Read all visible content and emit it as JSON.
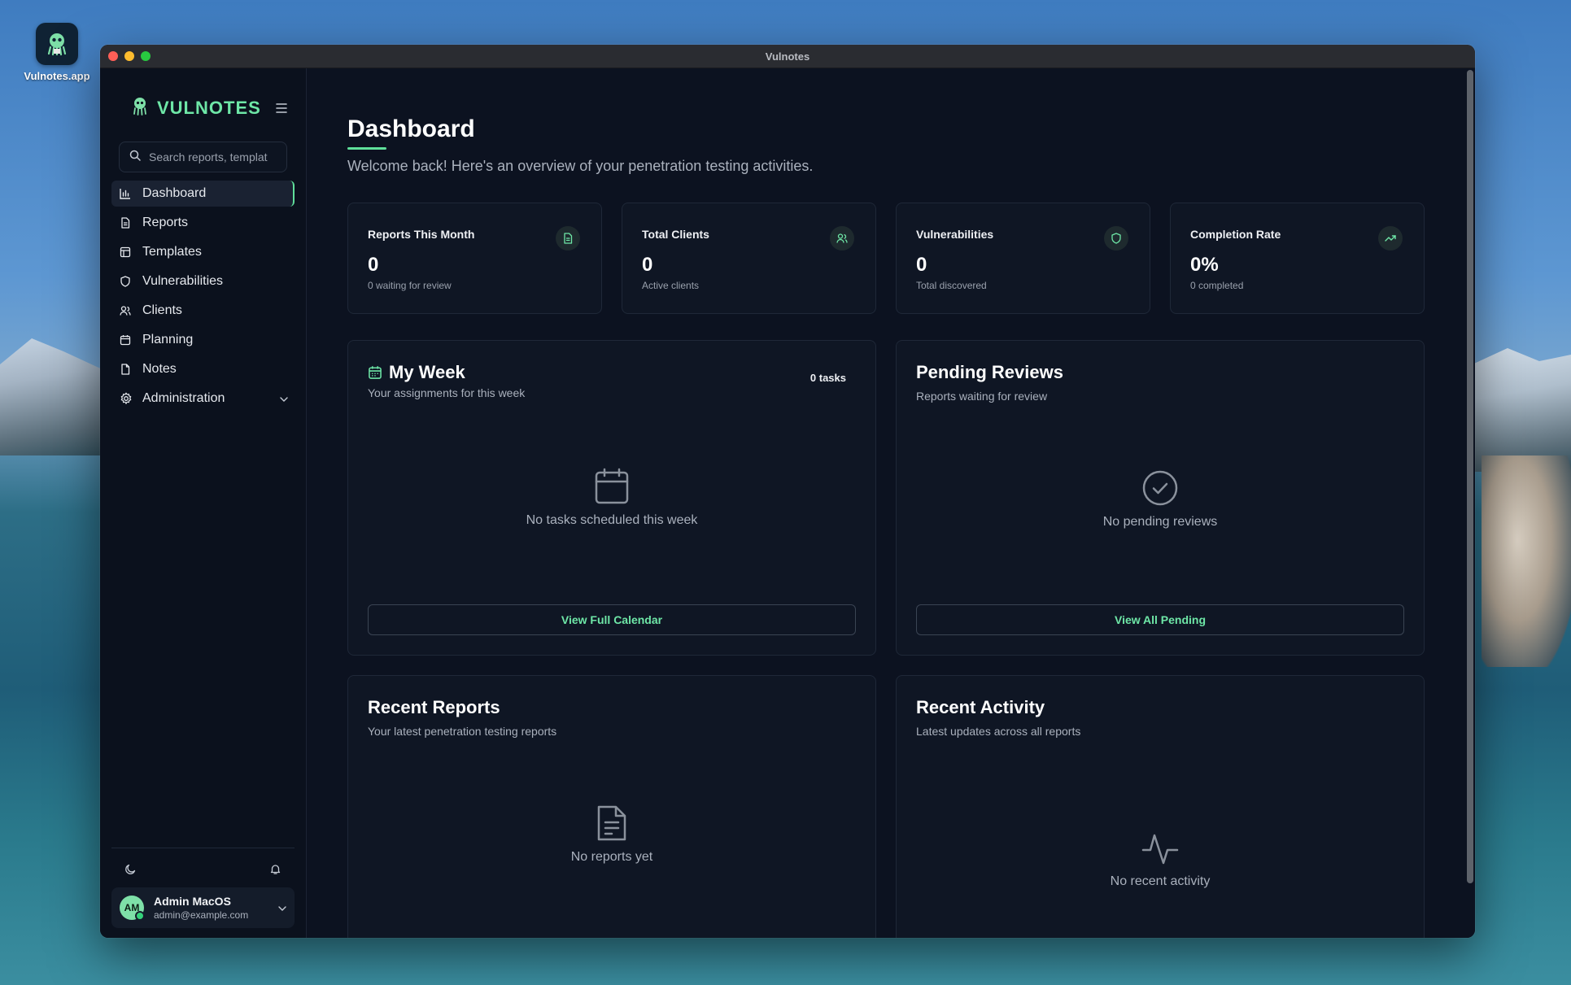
{
  "desktop": {
    "app_icon_label": "Vulnotes.app"
  },
  "window": {
    "title": "Vulnotes"
  },
  "brand": {
    "name": "VULNOTES"
  },
  "search": {
    "placeholder": "Search reports, templat"
  },
  "nav": {
    "items": [
      {
        "label": "Dashboard",
        "icon": "bar-chart-icon",
        "active": true
      },
      {
        "label": "Reports",
        "icon": "file-icon"
      },
      {
        "label": "Templates",
        "icon": "layout-icon"
      },
      {
        "label": "Vulnerabilities",
        "icon": "shield-icon"
      },
      {
        "label": "Clients",
        "icon": "users-icon"
      },
      {
        "label": "Planning",
        "icon": "calendar-icon"
      },
      {
        "label": "Notes",
        "icon": "note-icon"
      },
      {
        "label": "Administration",
        "icon": "gear-icon"
      }
    ]
  },
  "user": {
    "initials": "AM",
    "name": "Admin MacOS",
    "email": "admin@example.com"
  },
  "page": {
    "title": "Dashboard",
    "subtitle": "Welcome back! Here's an overview of your penetration testing activities."
  },
  "stats": [
    {
      "label": "Reports This Month",
      "value": "0",
      "sub": "0 waiting for review",
      "icon": "document-icon"
    },
    {
      "label": "Total Clients",
      "value": "0",
      "sub": "Active clients",
      "icon": "users-icon"
    },
    {
      "label": "Vulnerabilities",
      "value": "0",
      "sub": "Total discovered",
      "icon": "shield-icon"
    },
    {
      "label": "Completion Rate",
      "value": "0%",
      "sub": "0 completed",
      "icon": "trending-up-icon"
    }
  ],
  "my_week": {
    "title": "My Week",
    "subtitle": "Your assignments for this week",
    "count": "0 tasks",
    "empty": "No tasks scheduled this week",
    "button": "View Full Calendar"
  },
  "pending_reviews": {
    "title": "Pending Reviews",
    "subtitle": "Reports waiting for review",
    "empty": "No pending reviews",
    "button": "View All Pending"
  },
  "recent_reports": {
    "title": "Recent Reports",
    "subtitle": "Your latest penetration testing reports",
    "empty": "No reports yet"
  },
  "recent_activity": {
    "title": "Recent Activity",
    "subtitle": "Latest updates across all reports",
    "empty": "No recent activity"
  },
  "colors": {
    "accent": "#6ee7a7",
    "background": "#0c1220",
    "panel": "#0f1624"
  }
}
